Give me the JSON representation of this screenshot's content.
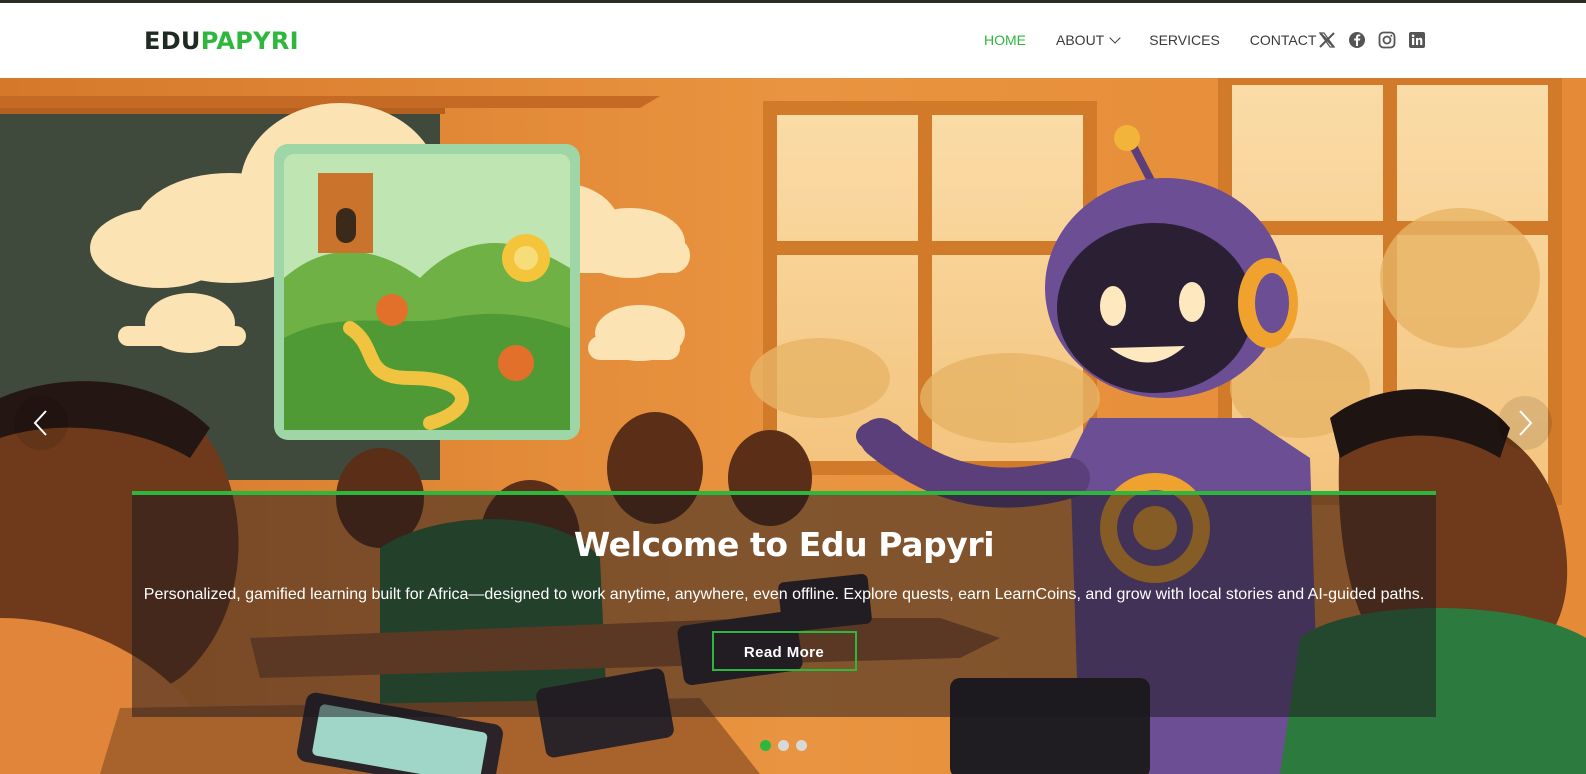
{
  "logo": {
    "part1": "EDU",
    "part2": "PAPYRI"
  },
  "nav": {
    "items": [
      {
        "label": "HOME"
      },
      {
        "label": "ABOUT"
      },
      {
        "label": "SERVICES"
      },
      {
        "label": "CONTACT"
      }
    ],
    "active": "HOME"
  },
  "socials": [
    "x-icon",
    "facebook-icon",
    "instagram-icon",
    "linkedin-icon"
  ],
  "hero": {
    "title": "Welcome to Edu Papyri",
    "text": "Personalized, gamified learning built for Africa—designed to work anytime, anywhere, even offline. Explore quests, earn LearnCoins, and grow with local stories and AI-guided paths.",
    "button": "Read More"
  },
  "carousel": {
    "slides": 3,
    "active_slide": 1
  },
  "colors": {
    "accent": "#2db83d",
    "logo_dark": "#1f2a22",
    "nav_text": "#3a3a3a"
  }
}
